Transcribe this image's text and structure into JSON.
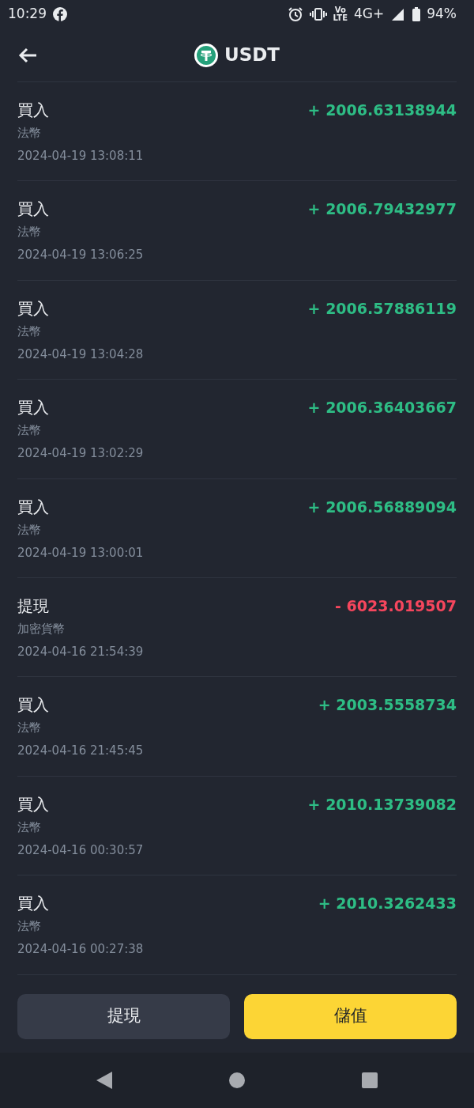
{
  "status_bar": {
    "time": "10:29",
    "volte_top": "Vo",
    "volte_bottom": "LTE",
    "network": "4G+",
    "battery": "94%"
  },
  "header": {
    "title": "USDT"
  },
  "transactions": [
    {
      "type": "買入",
      "method": "法幣",
      "time": "2024-04-19 13:08:11",
      "amount": "+ 2006.63138944",
      "kind": "in"
    },
    {
      "type": "買入",
      "method": "法幣",
      "time": "2024-04-19 13:06:25",
      "amount": "+ 2006.79432977",
      "kind": "in"
    },
    {
      "type": "買入",
      "method": "法幣",
      "time": "2024-04-19 13:04:28",
      "amount": "+ 2006.57886119",
      "kind": "in"
    },
    {
      "type": "買入",
      "method": "法幣",
      "time": "2024-04-19 13:02:29",
      "amount": "+ 2006.36403667",
      "kind": "in"
    },
    {
      "type": "買入",
      "method": "法幣",
      "time": "2024-04-19 13:00:01",
      "amount": "+ 2006.56889094",
      "kind": "in"
    },
    {
      "type": "提現",
      "method": "加密貨幣",
      "time": "2024-04-16 21:54:39",
      "amount": "- 6023.019507",
      "kind": "out"
    },
    {
      "type": "買入",
      "method": "法幣",
      "time": "2024-04-16 21:45:45",
      "amount": "+ 2003.5558734",
      "kind": "in"
    },
    {
      "type": "買入",
      "method": "法幣",
      "time": "2024-04-16 00:30:57",
      "amount": "+ 2010.13739082",
      "kind": "in"
    },
    {
      "type": "買入",
      "method": "法幣",
      "time": "2024-04-16 00:27:38",
      "amount": "+ 2010.3262433",
      "kind": "in"
    }
  ],
  "buttons": [
    {
      "label": "提現",
      "kind": "secondary"
    },
    {
      "label": "儲值",
      "kind": "primary"
    }
  ]
}
